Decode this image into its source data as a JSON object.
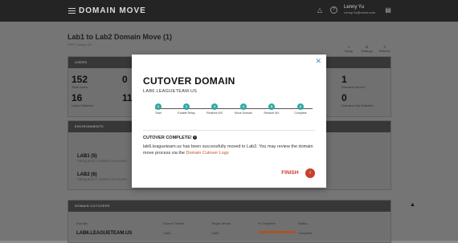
{
  "app": {
    "brand": "DOMAIN MOVE"
  },
  "user": {
    "name": "Lenny Yu",
    "email": "Lenny.Yu@xxxxx.com"
  },
  "page": {
    "title": "Lab1 to Lab2 Domain Move (1)",
    "subtitle": "FFFF, Lenny, US"
  },
  "actions": [
    "Setup",
    "Settings",
    "Refresh"
  ],
  "users_panel": {
    "header": "USERS",
    "stats": [
      {
        "value": "152",
        "label": "Total Users"
      },
      {
        "value": "0",
        "label": ""
      },
      {
        "value": "16",
        "label": "Users Matched"
      },
      {
        "value": "11",
        "label": ""
      },
      {
        "value": "1",
        "label": "Domains Moved"
      },
      {
        "value": "0",
        "label": "Domains Not Matched"
      }
    ]
  },
  "environments": {
    "header": "ENVIRONMENTS",
    "items": [
      {
        "name": "LAB1 (5)",
        "sub": "FREQUENCY: EVERY 24 HOURS"
      },
      {
        "name": "LAB2 (6)",
        "sub": "FREQUENCY: EVERY 24 HOURS"
      }
    ]
  },
  "cutovers": {
    "header": "DOMAIN CUTOVERS",
    "columns": [
      "Domain",
      "Source Tenant",
      "Target Tenant",
      "% Complete",
      "Status"
    ],
    "row": {
      "domain": "LAB6.LEAGUETEAM.US",
      "source": "LAB1",
      "target": "LAB2",
      "status": "Complete",
      "percent": 100
    }
  },
  "modal": {
    "title": "CUTOVER DOMAIN",
    "domain": "LAB6.LEAGUETEAM.US",
    "steps": [
      {
        "num": "1",
        "label": "Start"
      },
      {
        "num": "2",
        "label": "Enable Relay"
      },
      {
        "num": "3",
        "label": "Redirect MX"
      },
      {
        "num": "4",
        "label": "Move Domain"
      },
      {
        "num": "5",
        "label": "Restore MX"
      },
      {
        "num": "6",
        "label": "Complete"
      }
    ],
    "complete_heading": "CUTOVER COMPLETE!",
    "message": "lab6.leagueteam.us has been successfully moved to Lab2. You may review the domain move process via the",
    "link_text": "Domain Cutover Logs",
    "finish_label": "FINISH",
    "close_glyph": "✕",
    "finish_glyph": "›",
    "colors": {
      "step": "#31a8a0",
      "accent": "#c8402a"
    }
  }
}
